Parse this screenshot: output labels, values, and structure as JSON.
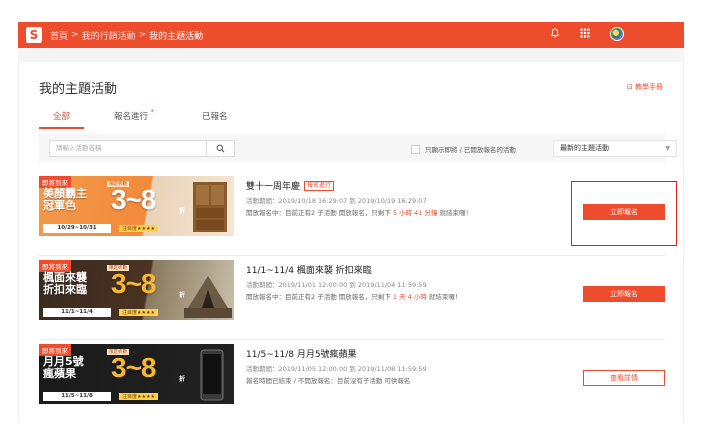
{
  "header": {
    "logo_letter": "S",
    "breadcrumb": [
      "首頁",
      "我的行銷活動",
      "我的主題活動"
    ],
    "separator": ">",
    "icons": [
      "bell-icon",
      "apps-grid-icon",
      "avatar"
    ]
  },
  "page": {
    "title": "我的主題活動",
    "help_link": "⊡ 教學手冊"
  },
  "tabs": [
    {
      "label": "全部",
      "active": true
    },
    {
      "label": "報名進行",
      "dot": "*"
    },
    {
      "label": "已報名"
    }
  ],
  "filter": {
    "search_placeholder": "請輸入活動名稱",
    "checkbox_label": "只顯示即將 / 已開放報名的活動",
    "sort_value": "最新的主題活動"
  },
  "campaigns": [
    {
      "banner_tag": "即將到來",
      "banner_title_1": "美顏霸主",
      "banner_title_2": "冠軍色",
      "banner_cap": "限定折數",
      "banner_num": "3~8",
      "banner_unit": "折",
      "banner_date": "10/29~10/31",
      "banner_stars": "注目度★★★★",
      "name": "雙十一周年慶",
      "badge": "報名進行",
      "time": "活動期間：2019/10/18 16:29:07 到 2019/10/19 16:29:07",
      "status_pre": "開放報名中：目前正有2 子活動 開放報名，只剩下",
      "status_hl": "5 小時 41 分鐘",
      "status_post": "就結束囉！",
      "button": "立即報名",
      "button_style": "fill"
    },
    {
      "banner_tag": "即將到來",
      "banner_title_1": "楓面來襲",
      "banner_title_2": "折扣來臨",
      "banner_cap": "限定折數",
      "banner_num": "3~8",
      "banner_unit": "折",
      "banner_date": "11/1~11/4",
      "banner_stars": "注目度★★★★",
      "name": "11/1~11/4 楓面來襲 折扣來臨",
      "badge": "",
      "time": "活動期間：2019/11/01 12:00:00 到 2019/11/04 11:59:59",
      "status_pre": "開放報名中：目前正有2 子活動 開放報名，只剩下",
      "status_hl": "1 天 4 小時",
      "status_post": "就結束囉！",
      "button": "立即報名",
      "button_style": "fill"
    },
    {
      "banner_tag": "即將到來",
      "banner_title_1": "月月5號",
      "banner_title_2": "瘋蘋果",
      "banner_cap": "限定折數",
      "banner_num": "3~8",
      "banner_unit": "折",
      "banner_date": "11/5~11/8",
      "banner_stars": "注目度★★★★",
      "name": "11/5~11/8 月月5號瘋蘋果",
      "badge": "",
      "time": "活動期間：2019/11/05 12:00:00 到 2019/11/08 11:59:59",
      "status_pre": "報名時間已結束 / 不開放報名：目前沒有子活動 可供報名",
      "status_hl": "",
      "status_post": "",
      "button": "查看詳情",
      "button_style": "outline"
    }
  ],
  "colors": {
    "brand": "#ee4d2d",
    "highlight_box": "#e02020"
  }
}
